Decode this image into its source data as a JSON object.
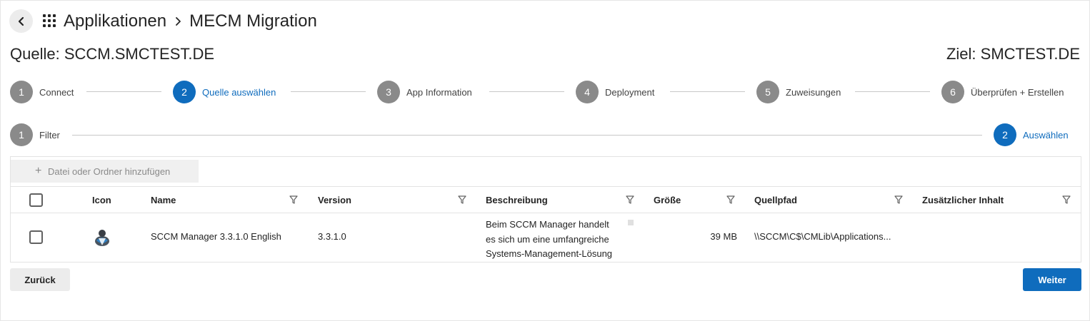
{
  "header": {
    "breadcrumb": [
      "Applikationen",
      "MECM Migration"
    ],
    "back_icon": "chevron-left-icon",
    "app_grid_icon": "app-grid-icon"
  },
  "source_label": "Quelle: SCCM.SMCTEST.DE",
  "target_label": "Ziel: SMCTEST.DE",
  "main_steps": [
    {
      "number": "1",
      "label": "Connect",
      "active": false
    },
    {
      "number": "2",
      "label": "Quelle auswählen",
      "active": true
    },
    {
      "number": "3",
      "label": "App Information",
      "active": false
    },
    {
      "number": "4",
      "label": "Deployment",
      "active": false
    },
    {
      "number": "5",
      "label": "Zuweisungen",
      "active": false
    },
    {
      "number": "6",
      "label": "Überprüfen + Erstellen",
      "active": false
    }
  ],
  "sub_steps": [
    {
      "number": "1",
      "label": "Filter",
      "active": false
    },
    {
      "number": "2",
      "label": "Auswählen",
      "active": true
    }
  ],
  "toolbar": {
    "add_label": "Datei oder Ordner hinzufügen"
  },
  "table": {
    "columns": [
      "Icon",
      "Name",
      "Version",
      "Beschreibung",
      "Größe",
      "Quellpfad",
      "Zusätzlicher Inhalt"
    ],
    "rows": [
      {
        "icon": "sccm-manager-app-icon",
        "name": "SCCM Manager 3.3.1.0 English",
        "version": "3.3.1.0",
        "description": [
          "Beim SCCM Manager handelt",
          "es sich um eine umfangreiche",
          "Systems-Management-Lösung"
        ],
        "size": "39 MB",
        "source_path": "\\\\SCCM\\C$\\CMLib\\Applications...",
        "additional_content": ""
      }
    ]
  },
  "footer": {
    "back_label": "Zurück",
    "next_label": "Weiter"
  },
  "colors": {
    "accent": "#0f6cbd",
    "inactive_step": "#8a8a8a"
  }
}
